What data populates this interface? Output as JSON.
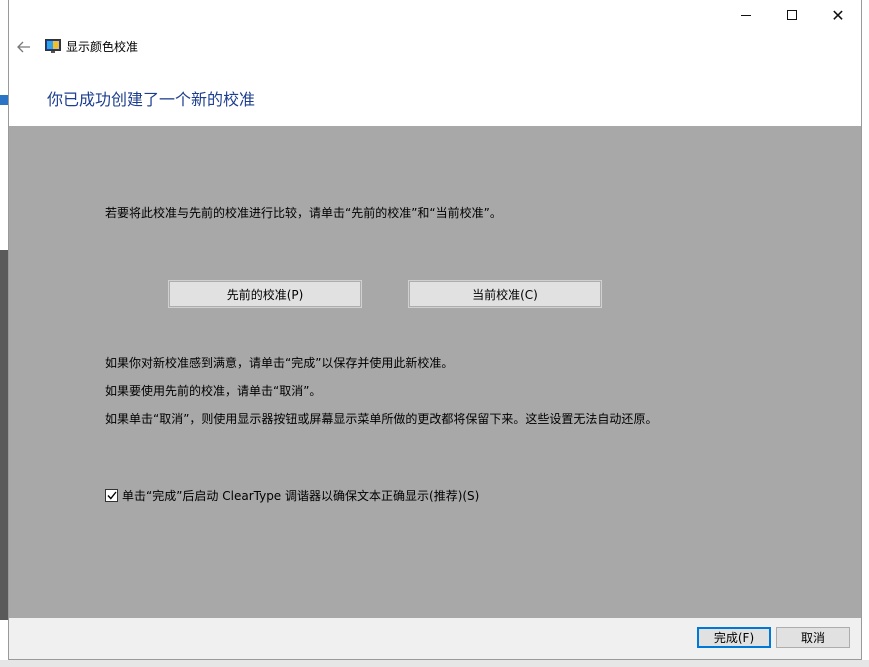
{
  "window": {
    "title": "显示颜色校准",
    "heading": "你已成功创建了一个新的校准"
  },
  "content": {
    "compare_text": "若要将此校准与先前的校准进行比较，请单击“先前的校准”和“当前校准”。",
    "previous_button": "先前的校准(P)",
    "current_button": "当前校准(C)",
    "info_line_1": "如果你对新校准感到满意，请单击“完成”以保存并使用此新校准。",
    "info_line_2": "如果要使用先前的校准，请单击“取消”。",
    "info_line_3": "如果单击“取消”，则使用显示器按钮或屏幕显示菜单所做的更改都将保留下来。这些设置无法自动还原。",
    "cleartype_checkbox": {
      "label": "单击“完成”后启动 ClearType 调谐器以确保文本正确显示(推荐)(S)",
      "checked": true
    }
  },
  "footer": {
    "finish_button": "完成(F)",
    "cancel_button": "取消"
  },
  "colors": {
    "heading": "#1e3f8f",
    "content_bg": "#a8a8a8",
    "accent": "#0078d7"
  }
}
